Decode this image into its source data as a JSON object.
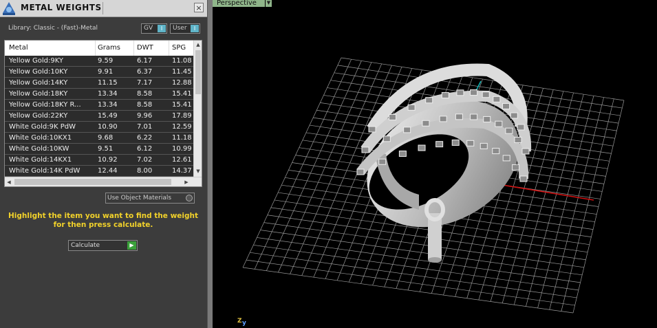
{
  "panel": {
    "title": "METAL WEIGHTS",
    "close_label": "×",
    "library": "Library: Classic - (Fast)-Metal",
    "gv_label": "GV",
    "user_label": "User",
    "use_object_materials": "Use Object Materials",
    "hint_line1": "Highlight the item you want to find the weight",
    "hint_line2": "for then press calculate.",
    "calculate_label": "Calculate"
  },
  "table": {
    "headers": [
      "Metal",
      "Grams",
      "DWT",
      "SPG"
    ],
    "rows": [
      [
        "Yellow Gold:9KY",
        "9.59",
        "6.17",
        "11.08"
      ],
      [
        "Yellow Gold:10KY",
        "9.91",
        "6.37",
        "11.45"
      ],
      [
        "Yellow Gold:14KY",
        "11.15",
        "7.17",
        "12.88"
      ],
      [
        "Yellow Gold:18KY",
        "13.34",
        "8.58",
        "15.41"
      ],
      [
        "Yellow Gold:18KY R...",
        "13.34",
        "8.58",
        "15.41"
      ],
      [
        "Yellow Gold:22KY",
        "15.49",
        "9.96",
        "17.89"
      ],
      [
        "White Gold:9K PdW",
        "10.90",
        "7.01",
        "12.59"
      ],
      [
        "White Gold:10KX1",
        "9.68",
        "6.22",
        "11.18"
      ],
      [
        "White Gold:10KW",
        "9.51",
        "6.12",
        "10.99"
      ],
      [
        "White Gold:14KX1",
        "10.92",
        "7.02",
        "12.61"
      ],
      [
        "White Gold:14K PdW",
        "12.44",
        "8.00",
        "14.37"
      ]
    ]
  },
  "viewport": {
    "view_label": "Perspective",
    "axis_z": "Z",
    "axis_y": "y"
  },
  "colors": {
    "hint": "#f2d22a",
    "accent": "#5fb4c8",
    "go": "#3aa03a",
    "x_axis": "#d01010",
    "y_axis": "#10b0b0"
  },
  "icons": [
    "app-logo-icon",
    "close-icon",
    "toggle-icon",
    "radio-icon",
    "play-icon",
    "dropdown-arrow-icon"
  ]
}
